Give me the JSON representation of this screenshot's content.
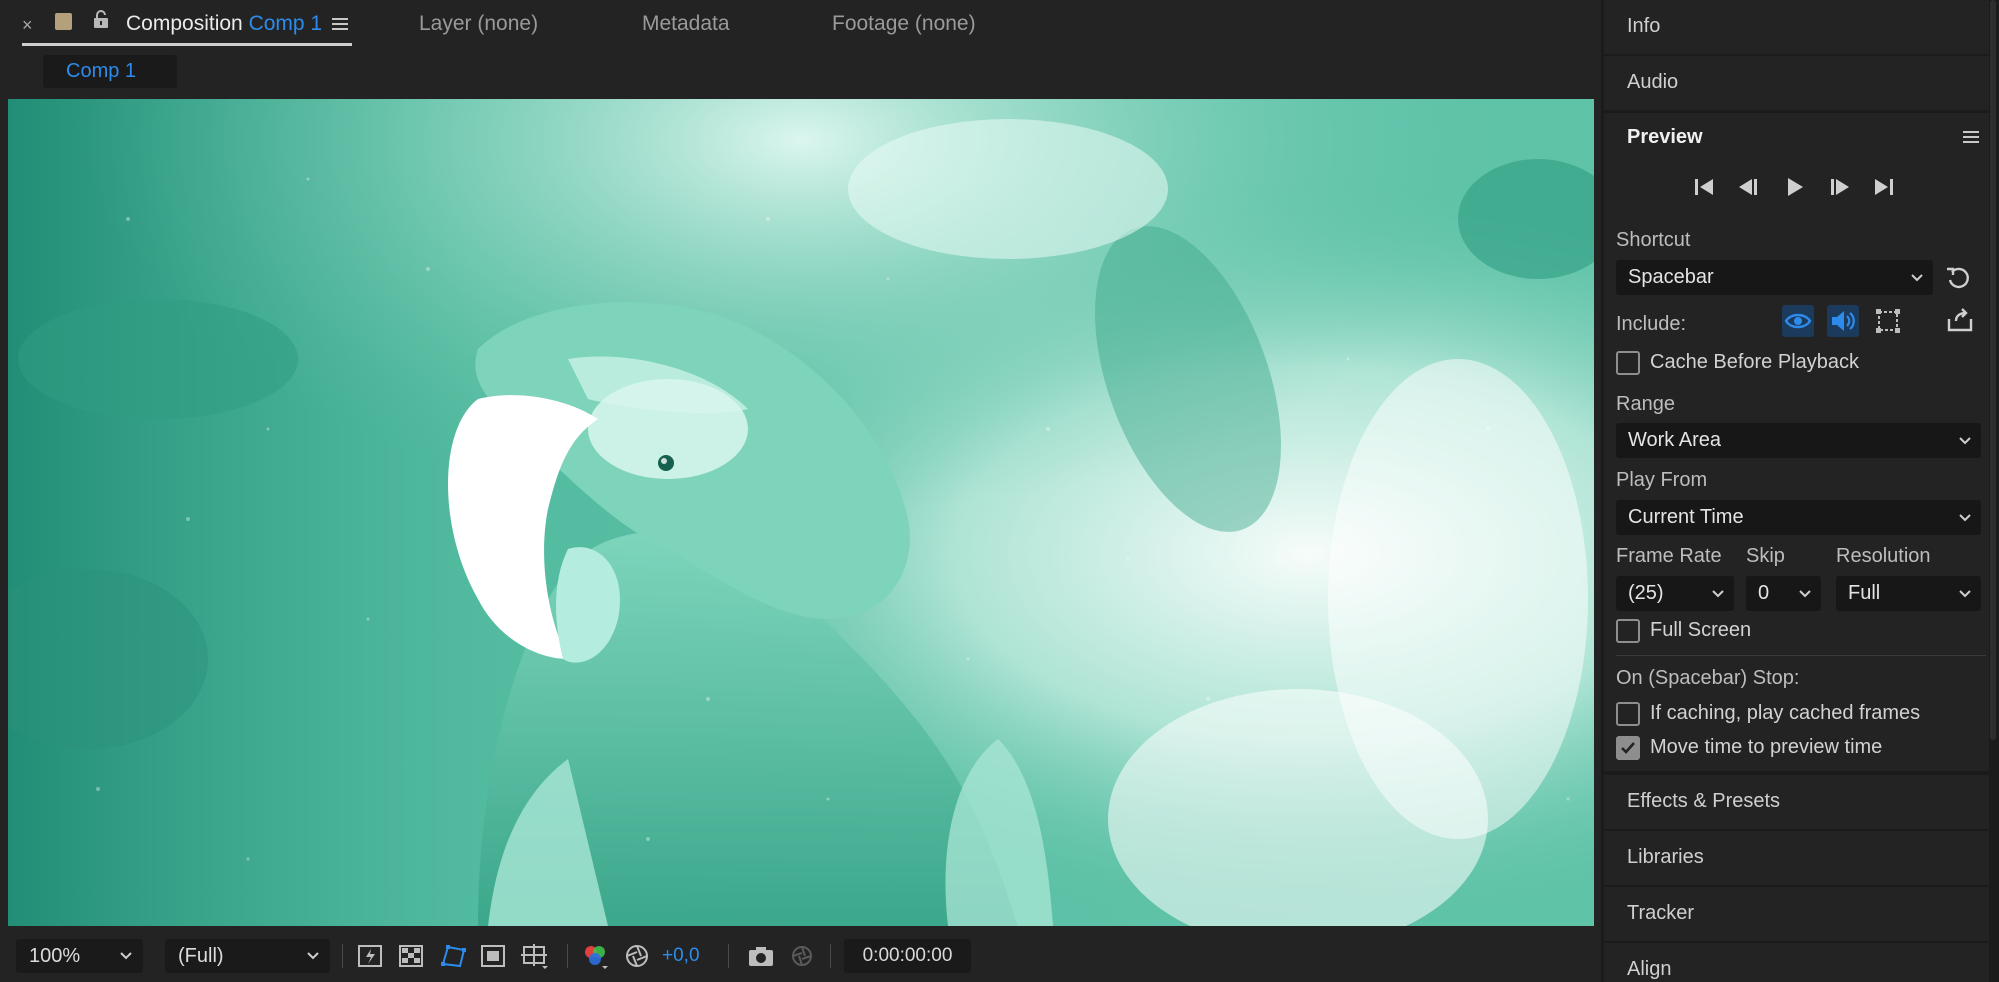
{
  "tabs": {
    "close_glyph": "×",
    "comp_prefix": "Composition",
    "comp_name": "Comp 1",
    "layer": "Layer (none)",
    "metadata": "Metadata",
    "footage": "Footage (none)"
  },
  "comp_chip": "Comp 1",
  "viewer": {
    "tint": "#5fc3a8",
    "content": "parrot-footage"
  },
  "bottom_bar": {
    "zoom": "100%",
    "resolution": "(Full)",
    "exposure": "+0,0",
    "timecode": "0:00:00:00"
  },
  "side_panels": {
    "info": "Info",
    "audio": "Audio",
    "preview": "Preview",
    "effects": "Effects & Presets",
    "libraries": "Libraries",
    "tracker": "Tracker",
    "align": "Align"
  },
  "preview": {
    "shortcut_label": "Shortcut",
    "shortcut_value": "Spacebar",
    "include_label": "Include:",
    "cache_before_playback": "Cache Before Playback",
    "range_label": "Range",
    "range_value": "Work Area",
    "play_from_label": "Play From",
    "play_from_value": "Current Time",
    "frame_rate_label": "Frame Rate",
    "frame_rate_value": "(25)",
    "skip_label": "Skip",
    "skip_value": "0",
    "resolution_label": "Resolution",
    "resolution_value": "Full",
    "full_screen": "Full Screen",
    "on_stop_label": "On (Spacebar) Stop:",
    "if_caching": "If caching, play cached frames",
    "move_time": "Move time to preview time",
    "cache_checked": false,
    "full_screen_checked": false,
    "if_caching_checked": false,
    "move_time_checked": true
  },
  "colors": {
    "accent": "#2d8ceb",
    "panel": "#232323",
    "panel_dark": "#1b1b1b"
  }
}
